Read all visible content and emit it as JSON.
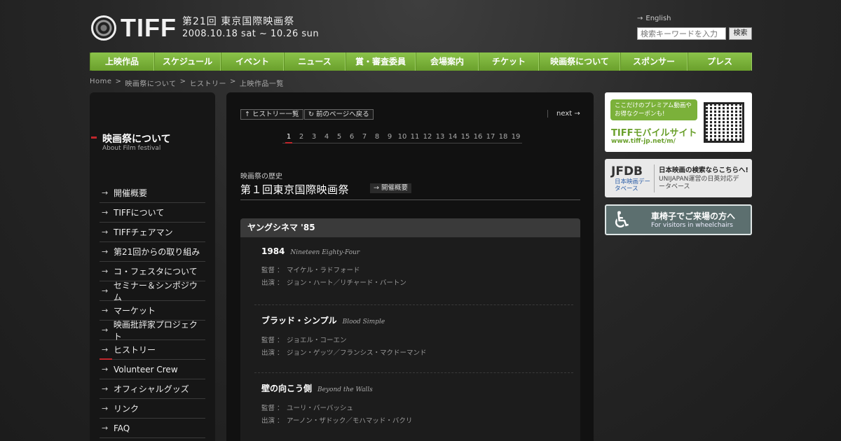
{
  "header": {
    "logo_text": "TIFF",
    "festival_name": "第21回 東京国際映画祭",
    "dates": "2008.10.18 sat ~ 10.26 sun",
    "english_link": "English",
    "search_placeholder": "検索キーワードを入力",
    "search_button": "検索"
  },
  "nav": [
    {
      "label": "上映作品",
      "w": 92
    },
    {
      "label": "スケジュール",
      "w": 95
    },
    {
      "label": "イベント",
      "w": 90
    },
    {
      "label": "ニュース",
      "w": 88
    },
    {
      "label": "賞・審査委員",
      "w": 100
    },
    {
      "label": "会場案内",
      "w": 90
    },
    {
      "label": "チケット",
      "w": 86
    },
    {
      "label": "映画祭について",
      "w": 116
    },
    {
      "label": "スポンサー",
      "w": 96
    },
    {
      "label": "プレス",
      "w": 92
    }
  ],
  "breadcrumb": [
    "Home",
    ">",
    "映画祭について",
    ">",
    "ヒストリー",
    ">",
    "上映作品一覧"
  ],
  "sidebar": {
    "title": "映画祭について",
    "subtitle": "About Film festival",
    "items": [
      "開催概要",
      "TIFFについて",
      "TIFFチェアマン",
      "第21回からの取り組み",
      "コ・フェスタについて",
      "セミナー＆シンポジウム",
      "マーケット",
      "映画批評家プロジェクト",
      "ヒストリー",
      "Volunteer Crew",
      "オフィシャルグッズ",
      "リンク",
      "FAQ"
    ],
    "active_index": 8
  },
  "main": {
    "history_list_btn": "ヒストリー一覧",
    "prev_page_btn": "前のページへ戻る",
    "next_label": "next →",
    "pages": [
      "1",
      "2",
      "3",
      "4",
      "5",
      "6",
      "7",
      "8",
      "9",
      "10",
      "11",
      "12",
      "13",
      "14",
      "15",
      "16",
      "17",
      "18",
      "19"
    ],
    "current_page": "1",
    "history_label": "映画祭の歴史",
    "history_title": "第１回東京国際映画祭",
    "overview_btn": "開催概要",
    "section_title": "ヤングシネマ '85",
    "films": [
      {
        "title": "1984",
        "title_en": "Nineteen Eighty-Four",
        "director_label": "監督 ：",
        "director": "マイケル・ラドフォード",
        "cast_label": "出演 ：",
        "cast": "ジョン・ハート／リチャード・バートン"
      },
      {
        "title": "ブラッド・シンプル",
        "title_en": "Blood Simple",
        "director_label": "監督 ：",
        "director": "ジョエル・コーエン",
        "cast_label": "出演 ：",
        "cast": "ジョン・ゲッツ／フランシス・マクドーマンド"
      },
      {
        "title": "壁の向こう側",
        "title_en": "Beyond the Walls",
        "director_label": "監督 ：",
        "director": "ユーリ・バーバッシュ",
        "cast_label": "出演 ：",
        "cast": "アーノン・ザドック／モハマッド・バクリ"
      }
    ]
  },
  "banners": {
    "mobile_bubble": "ここだけのプレミアム動画やお得なクーポンも!",
    "mobile_title": "TIFFモバイルサイト",
    "mobile_url": "www.tiff-jp.net/m/",
    "jfdb": "JFDB",
    "jfdb_sub": "日本映画データベース",
    "jfdb_line1": "日本映画の検索ならこちらへ!",
    "jfdb_line2": "UNIJAPAN運営の日英対応データベース",
    "wheelchair_title": "車椅子でご来場の方へ",
    "wheelchair_sub": "For visitors in wheelchairs"
  },
  "colors": {
    "nav_green": "#7bb13a",
    "accent_red": "#c0262c"
  }
}
